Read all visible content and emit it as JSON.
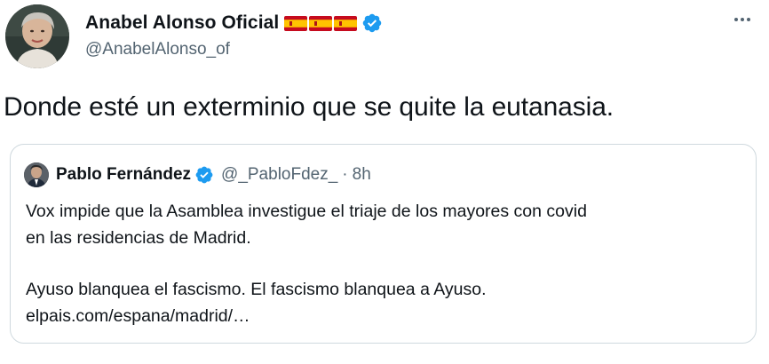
{
  "author": {
    "display_name": "Anabel Alonso Oficial",
    "handle": "@AnabelAlonso_of",
    "flags": [
      "spain-flag",
      "spain-flag",
      "spain-flag"
    ],
    "verified_icon": "verified-badge-icon"
  },
  "tweet": {
    "text": "Donde esté un exterminio que se quite la eutanasia."
  },
  "quoted_tweet": {
    "display_name": "Pablo Fernández",
    "handle": "@_PabloFdez_",
    "separator": "·",
    "time": "8h",
    "lines": [
      "Vox impide que la Asamblea investigue el triaje de los mayores con covid",
      "en las residencias de Madrid.",
      "Ayuso blanquea el fascismo. El fascismo blanquea a Ayuso.",
      "elpais.com/espana/madrid/…"
    ]
  },
  "colors": {
    "text": "#0f1419",
    "secondary": "#536471",
    "verified": "#1d9bf0",
    "border": "#cfd9de",
    "flag_red": "#c60b1e",
    "flag_yellow": "#ffc400"
  },
  "icons": {
    "more": "more-options-icon"
  }
}
